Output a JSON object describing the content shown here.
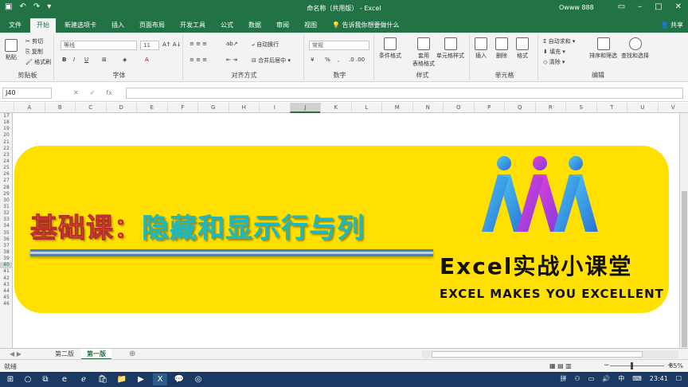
{
  "titlebar": {
    "document_title": "命名称（共用版） - Excel",
    "user": "Owww 888",
    "qat_icons": [
      "save-icon",
      "undo-icon",
      "redo-icon",
      "customize-icon"
    ],
    "window_controls": [
      "restore-ribbon-icon",
      "minimize-icon",
      "maximize-icon",
      "close-icon"
    ]
  },
  "tabs": [
    "文件",
    "开始",
    "新建选项卡",
    "插入",
    "页面布局",
    "开发工具",
    "公式",
    "数据",
    "审阅",
    "视图"
  ],
  "active_tab": "开始",
  "tell_me": "告诉我你想要做什么",
  "share": "共享",
  "ribbon": {
    "clipboard": {
      "label": "剪贴板",
      "paste": "粘贴",
      "cut": "剪切",
      "copy": "复制",
      "format_painter": "格式刷"
    },
    "font": {
      "label": "字体",
      "family": "等线",
      "size": "11"
    },
    "alignment": {
      "label": "对齐方式",
      "wrap": "自动换行",
      "merge": "合并后居中"
    },
    "number": {
      "label": "数字",
      "format": "常规",
      "percent": "%",
      "comma": ","
    },
    "styles": {
      "label": "样式",
      "conditional": "条件格式",
      "table1": "套用",
      "table2": "表格格式",
      "cell_styles": "单元格样式"
    },
    "cells": {
      "label": "单元格",
      "insert": "插入",
      "delete": "删除",
      "format": "格式"
    },
    "editing": {
      "label": "编辑",
      "autosum": "自动求和",
      "fill": "填充",
      "clear": "清除",
      "sort": "排序和筛选",
      "find": "查找和选择"
    }
  },
  "formula_bar": {
    "name_box": "J40",
    "fx": "fx",
    "value": ""
  },
  "columns": [
    "A",
    "B",
    "C",
    "D",
    "E",
    "F",
    "G",
    "H",
    "I",
    "J",
    "K",
    "L",
    "M",
    "N",
    "O",
    "P",
    "Q",
    "R",
    "S",
    "T",
    "U",
    "V"
  ],
  "selected_column": "J",
  "rows": [
    "17",
    "18",
    "19",
    "20",
    "21",
    "22",
    "23",
    "24",
    "25",
    "26",
    "27",
    "28",
    "29",
    "30",
    "31",
    "32",
    "33",
    "34",
    "35",
    "36",
    "37",
    "38",
    "39",
    "40",
    "41",
    "42",
    "43",
    "44",
    "45",
    "46"
  ],
  "selected_row": "40",
  "banner": {
    "title_part1": "基础课：",
    "title_part2": "隐藏和显示行与列",
    "brand": "Excel实战小课堂",
    "slogan": "EXCEL MAKES YOU EXCELLENT",
    "colors": {
      "background": "#ffe000",
      "title1": "#e8882a",
      "title2": "#1db8c2"
    }
  },
  "sheets": [
    "第二版",
    "第一版"
  ],
  "active_sheet": "第一版",
  "status": {
    "ready": "就绪",
    "zoom": "85%"
  },
  "taskbar": {
    "time": "23:41",
    "ime": "中",
    "tray": "拼"
  }
}
